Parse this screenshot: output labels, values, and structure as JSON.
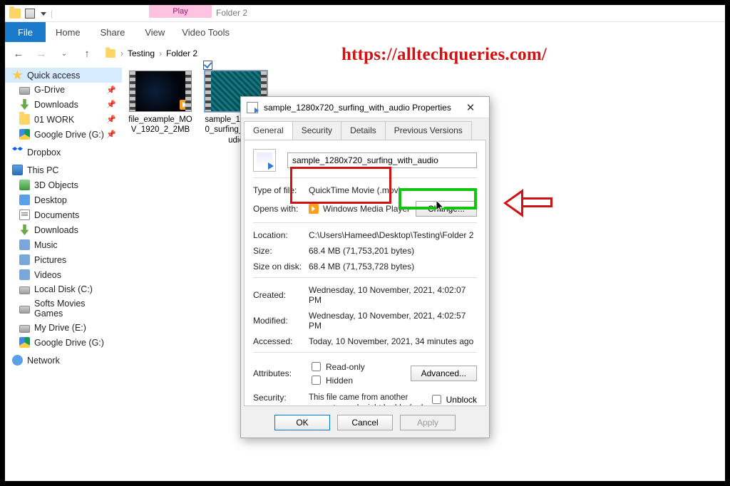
{
  "titlebar": {
    "context_tab": "Play",
    "context_group": "Video Tools",
    "window_hint": "Folder 2"
  },
  "ribbon": {
    "file": "File",
    "home": "Home",
    "share": "Share",
    "view": "View"
  },
  "breadcrumb": {
    "level1": "Testing",
    "level2": "Folder 2",
    "sep": "›"
  },
  "watermark": "https://alltechqueries.com/",
  "sidebar": {
    "quick_access": "Quick access",
    "items_quick": [
      {
        "label": "G-Drive",
        "icon": "drive",
        "pinned": true
      },
      {
        "label": "Downloads",
        "icon": "dl",
        "pinned": true
      },
      {
        "label": "01 WORK",
        "icon": "folder",
        "pinned": true
      },
      {
        "label": "Google Drive (G:)",
        "icon": "gdrive",
        "pinned": true
      }
    ],
    "dropbox": "Dropbox",
    "thispc": "This PC",
    "items_pc": [
      {
        "label": "3D Objects",
        "icon": "obj"
      },
      {
        "label": "Desktop",
        "icon": "desk"
      },
      {
        "label": "Documents",
        "icon": "doc"
      },
      {
        "label": "Downloads",
        "icon": "dl"
      },
      {
        "label": "Music",
        "icon": "mus"
      },
      {
        "label": "Pictures",
        "icon": "pic"
      },
      {
        "label": "Videos",
        "icon": "vid"
      },
      {
        "label": "Local Disk (C:)",
        "icon": "drive"
      },
      {
        "label": "Softs Movies Games",
        "icon": "drive"
      },
      {
        "label": "My Drive (E:)",
        "icon": "drive"
      },
      {
        "label": "Google Drive (G:)",
        "icon": "gdrive"
      }
    ],
    "network": "Network"
  },
  "files": [
    {
      "name": "file_example_MOV_1920_2_2MB"
    },
    {
      "name": "sample_1280x720_surfing_with_audio"
    }
  ],
  "dialog": {
    "title": "sample_1280x720_surfing_with_audio Properties",
    "tabs": {
      "general": "General",
      "security": "Security",
      "details": "Details",
      "prev": "Previous Versions"
    },
    "filename": "sample_1280x720_surfing_with_audio",
    "labels": {
      "type": "Type of file:",
      "opens": "Opens with:",
      "location": "Location:",
      "size": "Size:",
      "sizedisk": "Size on disk:",
      "created": "Created:",
      "modified": "Modified:",
      "accessed": "Accessed:",
      "attributes": "Attributes:",
      "security": "Security:"
    },
    "values": {
      "type": "QuickTime Movie (.mov)",
      "opens": "Windows Media Player",
      "change": "Change...",
      "location": "C:\\Users\\Hameed\\Desktop\\Testing\\Folder 2",
      "size": "68.4 MB (71,753,201 bytes)",
      "sizedisk": "68.4 MB (71,753,728 bytes)",
      "created": "Wednesday, 10 November, 2021, 4:02:07 PM",
      "modified": "Wednesday, 10 November, 2021, 4:02:57 PM",
      "accessed": "Today, 10 November, 2021, 34 minutes ago",
      "readonly": "Read-only",
      "hidden": "Hidden",
      "advanced": "Advanced...",
      "sec_msg": "This file came from another computer and might be blocked to help protect this computer.",
      "unblock": "Unblock"
    },
    "buttons": {
      "ok": "OK",
      "cancel": "Cancel",
      "apply": "Apply"
    }
  }
}
